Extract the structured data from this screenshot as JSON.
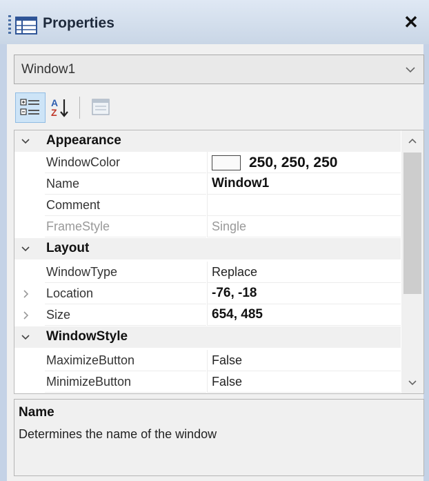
{
  "window": {
    "title": "Properties",
    "title_icon": "properties-window-icon",
    "close_icon": "close-icon"
  },
  "selector": {
    "value": "Window1",
    "arrow_icon": "chevron-down-icon"
  },
  "toolbar": {
    "categorized_icon": "categorized-view-icon",
    "alphabetical_icon": "alphabetical-sort-icon",
    "property_pages_icon": "property-pages-icon",
    "categorized_active": true
  },
  "grid": {
    "categories": [
      {
        "label": "Appearance",
        "expanded": true,
        "properties": [
          {
            "name": "WindowColor",
            "value": "250, 250, 250",
            "bold": true,
            "swatch": "#fafafa"
          },
          {
            "name": "Name",
            "value": "Window1",
            "bold": true
          },
          {
            "name": "Comment",
            "value": ""
          },
          {
            "name": "FrameStyle",
            "value": "Single",
            "disabled": true
          }
        ]
      },
      {
        "label": "Layout",
        "expanded": true,
        "properties": [
          {
            "name": "WindowType",
            "value": "Replace"
          },
          {
            "name": "Location",
            "value": "-76, -18",
            "bold": true,
            "expandable": true
          },
          {
            "name": "Size",
            "value": "654, 485",
            "bold": true,
            "expandable": true
          }
        ]
      },
      {
        "label": "WindowStyle",
        "expanded": true,
        "properties": [
          {
            "name": "MaximizeButton",
            "value": "False"
          },
          {
            "name": "MinimizeButton",
            "value": "False"
          }
        ]
      }
    ]
  },
  "description": {
    "title": "Name",
    "text": "Determines the name of the window"
  },
  "colors": {
    "titlebar": "#c9d6e6",
    "selected_toolbar": "#cde4f7",
    "category_bg": "#f0f0f0"
  }
}
